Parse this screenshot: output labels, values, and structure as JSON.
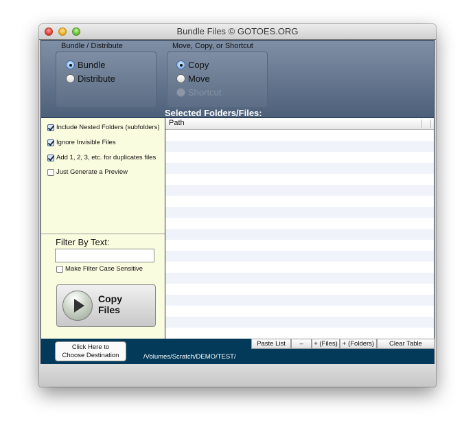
{
  "window": {
    "title": "Bundle Files © GOTOES.ORG"
  },
  "header": {
    "group1": {
      "label": "Bundle / Distribute",
      "options": [
        {
          "label": "Bundle",
          "selected": true,
          "enabled": true
        },
        {
          "label": "Distribute",
          "selected": false,
          "enabled": true
        }
      ]
    },
    "group2": {
      "label": "Move, Copy, or Shortcut",
      "options": [
        {
          "label": "Copy",
          "selected": true,
          "enabled": true
        },
        {
          "label": "Move",
          "selected": false,
          "enabled": true
        },
        {
          "label": "Shortcut",
          "selected": false,
          "enabled": false
        }
      ]
    },
    "selected_label": "Selected Folders/Files:"
  },
  "options": [
    {
      "label": "Include Nested Folders (subfolders)",
      "checked": true
    },
    {
      "label": "Ignore Invisible Files",
      "checked": true
    },
    {
      "label": "Add 1, 2, 3, etc. for duplicates files",
      "checked": true
    },
    {
      "label": "Just Generate a Preview",
      "checked": false
    }
  ],
  "filter": {
    "label": "Filter By Text:",
    "value": "",
    "case_sensitive_label": "Make Filter Case Sensitive",
    "case_sensitive": false
  },
  "copy_button": {
    "line1": "Copy",
    "line2": "Files",
    "icon": "play-icon"
  },
  "table": {
    "columns": [
      "Path"
    ],
    "rows": []
  },
  "footer": {
    "dest_button_line1": "Click Here to",
    "dest_button_line2": "Choose Destination",
    "dest_path": "/Volumes/Scratch/DEMO/TEST/",
    "table_buttons": [
      "Paste List",
      "–",
      "+ (Files)",
      "+ (Folders)",
      "Clear Table"
    ]
  }
}
